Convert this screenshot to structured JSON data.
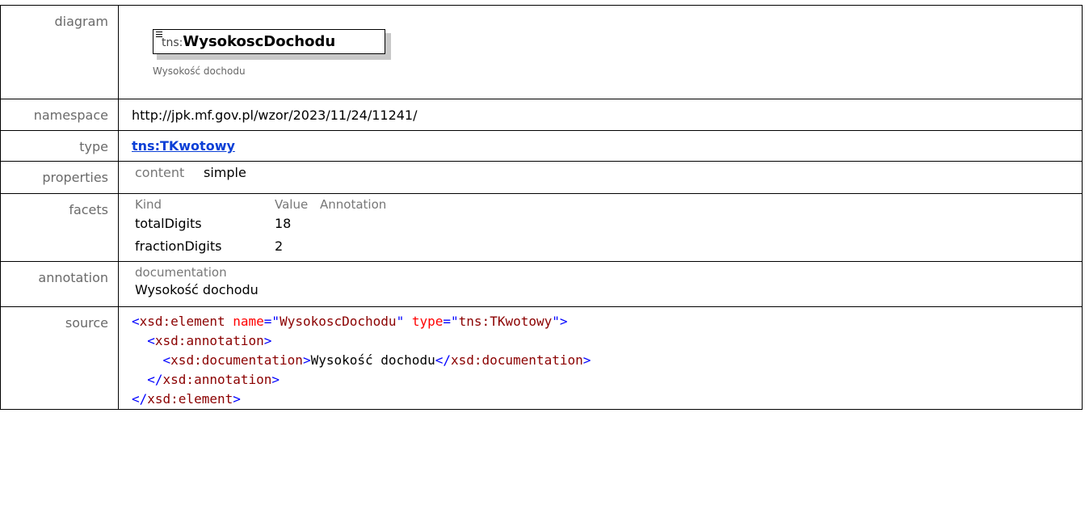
{
  "labels": {
    "diagram": "diagram",
    "namespace": "namespace",
    "type": "type",
    "properties": "properties",
    "facets": "facets",
    "annotation": "annotation",
    "source": "source"
  },
  "diagram": {
    "prefix": "tns:",
    "name": "WysokoscDochodu",
    "caption": "Wysokość dochodu"
  },
  "namespace": "http://jpk.mf.gov.pl/wzor/2023/11/24/11241/",
  "type": "tns:TKwotowy",
  "properties": {
    "key": "content",
    "value": "simple"
  },
  "facets": {
    "headers": [
      "Kind",
      "Value",
      "Annotation"
    ],
    "rows": [
      {
        "kind": "totalDigits",
        "value": "18",
        "annotation": ""
      },
      {
        "kind": "fractionDigits",
        "value": "2",
        "annotation": ""
      }
    ]
  },
  "annotation": {
    "label": "documentation",
    "text": "Wysokość dochodu"
  },
  "source": {
    "element_open": "xsd:element",
    "attr_name": "name",
    "attr_name_val": "WysokoscDochodu",
    "attr_type": "type",
    "attr_type_val": "tns:TKwotowy",
    "annotation_tag": "xsd:annotation",
    "documentation_tag": "xsd:documentation",
    "documentation_text": "Wysokość dochodu"
  },
  "colors": {
    "link": "#0b3fd6",
    "tag": "#8b0000",
    "bracket": "#0000ff",
    "attribute": "#ff0000",
    "label": "#6a6a6a"
  }
}
